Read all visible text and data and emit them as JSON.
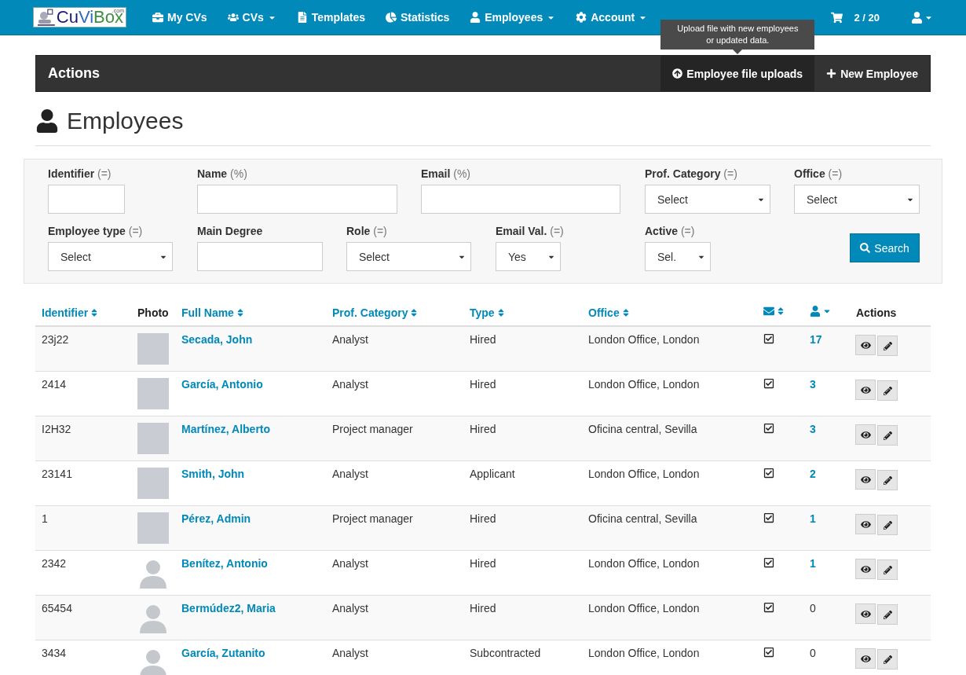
{
  "navbar": {
    "logo": {
      "parts": [
        "Cu",
        "Vi",
        "Box"
      ],
      "suffix": ".com"
    },
    "items": [
      {
        "label": "My CVs",
        "has_menu": false
      },
      {
        "label": "CVs",
        "has_menu": true
      },
      {
        "label": "Templates",
        "has_menu": false
      },
      {
        "label": "Statistics",
        "has_menu": false
      },
      {
        "label": "Employees",
        "has_menu": true
      },
      {
        "label": "Account",
        "has_menu": true
      }
    ],
    "cart": "2 / 20"
  },
  "actions_bar": {
    "title": "Actions",
    "buttons": [
      {
        "label": "Employee file uploads",
        "hovered": true,
        "tooltip": "Upload file with new employees or updated data."
      },
      {
        "label": "New Employee",
        "hovered": false
      }
    ]
  },
  "page_title": "Employees",
  "filters": [
    [
      {
        "label": "Identifier",
        "qualifier": "(=)",
        "kind": "input"
      },
      {
        "label": "Name",
        "qualifier": "(%)",
        "kind": "input"
      },
      {
        "label": "Email",
        "qualifier": "(%)",
        "kind": "input"
      },
      {
        "label": "Prof. Category",
        "qualifier": "(=)",
        "kind": "select",
        "value": "Select"
      },
      {
        "label": "Office",
        "qualifier": "(=)",
        "kind": "select",
        "value": "Select"
      }
    ],
    [
      {
        "label": "Employee type",
        "qualifier": "(=)",
        "kind": "select",
        "value": "Select"
      },
      {
        "label": "Main Degree",
        "kind": "input"
      },
      {
        "label": "Role",
        "qualifier": "(=)",
        "kind": "select",
        "value": "Select"
      },
      {
        "label": "Email Val.",
        "qualifier": "(=)",
        "kind": "select",
        "value": "Yes"
      },
      {
        "label": "Active",
        "qualifier": "(=)",
        "kind": "select",
        "value": "Sel."
      }
    ]
  ],
  "search_button": "Search",
  "table": {
    "columns": [
      {
        "label": "Identifier",
        "kind": "text",
        "sortable": true
      },
      {
        "label": "Photo",
        "kind": "text",
        "sortable": false
      },
      {
        "label": "Full Name",
        "kind": "text",
        "sortable": true
      },
      {
        "label": "Prof. Category",
        "kind": "text",
        "sortable": true
      },
      {
        "label": "Type",
        "kind": "text",
        "sortable": true
      },
      {
        "label": "Office",
        "kind": "text",
        "sortable": true
      },
      {
        "kind": "mail",
        "sortable": true
      },
      {
        "kind": "user",
        "sortable": false
      },
      {
        "label": "Actions",
        "kind": "text",
        "sortable": false
      }
    ],
    "rows": [
      {
        "identifier": "23j22",
        "kind": "photo",
        "name": "Secada, John",
        "category": "Analyst",
        "type": "Hired",
        "office": "London Office, London",
        "email_validated": true,
        "count": "17"
      },
      {
        "identifier": "2414",
        "kind": "photo",
        "name": "García, Antonio",
        "category": "Analyst",
        "type": "Hired",
        "office": "London Office, London",
        "email_validated": true,
        "count": "3"
      },
      {
        "identifier": "I2H32",
        "kind": "photo",
        "name": "Martínez, Alberto",
        "category": "Project manager",
        "type": "Hired",
        "office": "Oficina central, Sevilla",
        "email_validated": true,
        "count": "3"
      },
      {
        "identifier": "23141",
        "kind": "photo",
        "name": "Smith, John",
        "category": "Analyst",
        "type": "Applicant",
        "office": "London Office, London",
        "email_validated": true,
        "count": "2"
      },
      {
        "identifier": "1",
        "kind": "photo",
        "name": "Pérez, Admin",
        "category": "Project manager",
        "type": "Hired",
        "office": "Oficina central, Sevilla",
        "email_validated": true,
        "count": "1"
      },
      {
        "identifier": "2342",
        "kind": "avatar",
        "name": "Benítez, Antonio",
        "category": "Analyst",
        "type": "Hired",
        "office": "London Office, London",
        "email_validated": true,
        "count": "1"
      },
      {
        "identifier": "65454",
        "kind": "avatar",
        "name": "Bermúdez2, Maria",
        "category": "Analyst",
        "type": "Hired",
        "office": "London Office, London",
        "email_validated": true,
        "count": "0"
      },
      {
        "identifier": "3434",
        "kind": "avatar",
        "name": "García, Zutanito",
        "category": "Analyst",
        "type": "Subcontracted",
        "office": "London Office, London",
        "email_validated": true,
        "count": "0"
      }
    ]
  }
}
